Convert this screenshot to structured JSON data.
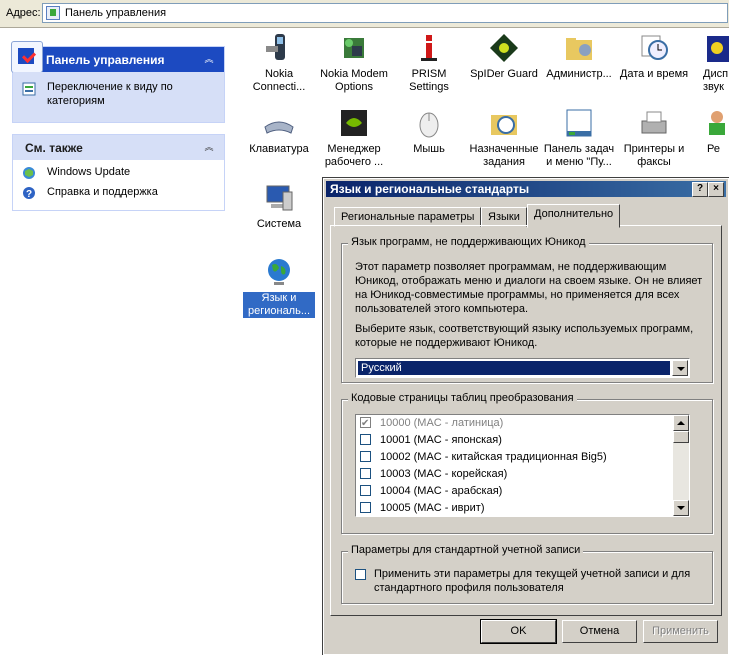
{
  "address": {
    "label": "Адрес:",
    "value": "Панель управления"
  },
  "left": {
    "pane1": {
      "title": "Панель управления",
      "link": "Переключение к виду по категориям"
    },
    "pane2": {
      "title": "См. также",
      "items": [
        "Windows Update",
        "Справка и поддержка"
      ]
    }
  },
  "icons": [
    {
      "name": "Nokia\nConnecti...",
      "icon": "phone-icon"
    },
    {
      "name": "Nokia Modem\nOptions",
      "icon": "modem-icon"
    },
    {
      "name": "PRISM\nSettings",
      "icon": "info-icon"
    },
    {
      "name": "SpIDer Guard",
      "icon": "spider-icon"
    },
    {
      "name": "Администр...",
      "icon": "admin-tools-icon"
    },
    {
      "name": "Дата и время",
      "icon": "clock-icon"
    },
    {
      "name": "Дисп\nзвук",
      "icon": "sound-icon"
    },
    {
      "name": "Клавиатура",
      "icon": "keyboard-icon"
    },
    {
      "name": "Менеджер\nрабочего ...",
      "icon": "nvidia-icon"
    },
    {
      "name": "Мышь",
      "icon": "mouse-icon"
    },
    {
      "name": "Назначенные\nзадания",
      "icon": "tasks-icon"
    },
    {
      "name": "Панель задач\nи меню \"Пу...",
      "icon": "taskbar-icon"
    },
    {
      "name": "Принтеры и\nфаксы",
      "icon": "printer-icon"
    },
    {
      "name": "Ре",
      "icon": "user-icon"
    },
    {
      "name": "Система",
      "icon": "system-icon"
    },
    {
      "name": "Язык и\nрегиональ...",
      "icon": "globe-icon"
    }
  ],
  "dialog": {
    "title": "Язык и региональные стандарты",
    "help_btn": "?",
    "close_btn": "×",
    "tabs": [
      "Региональные параметры",
      "Языки",
      "Дополнительно"
    ],
    "active_tab": 2,
    "group1": {
      "title": "Язык программ, не поддерживающих Юникод",
      "text1": "Этот параметр позволяет программам, не поддерживающим Юникод, отображать меню и диалоги на своем языке. Он не влияет на Юникод-совместимые программы, но применяется для всех пользователей этого компьютера.",
      "text2": "Выберите язык, соответствующий языку используемых программ, которые не поддерживают Юникод.",
      "selected_language": "Русский"
    },
    "group2": {
      "title": "Кодовые страницы таблиц преобразования",
      "items": [
        {
          "label": "10000 (MAC - латиница)",
          "checked": true,
          "dim": true
        },
        {
          "label": "10001 (MAC - японская)",
          "checked": false,
          "dim": false
        },
        {
          "label": "10002 (MAC - китайская традиционная Big5)",
          "checked": false,
          "dim": false
        },
        {
          "label": "10003 (MAC - корейская)",
          "checked": false,
          "dim": false
        },
        {
          "label": "10004 (MAC - арабская)",
          "checked": false,
          "dim": false
        },
        {
          "label": "10005 (MAC - иврит)",
          "checked": false,
          "dim": false
        }
      ]
    },
    "group3": {
      "title": "Параметры для стандартной учетной записи",
      "checkbox_label": "Применить эти параметры для текущей учетной записи и для стандартного профиля пользователя",
      "checked": false
    },
    "buttons": {
      "ok": "OK",
      "cancel": "Отмена",
      "apply": "Применить"
    }
  },
  "colors": {
    "pane_header": "#1c4ac1",
    "pane_bg": "#d6dff7",
    "dialog_bg": "#d4d0c8",
    "title_start": "#0a246a",
    "title_end": "#3a6ea5",
    "selection": "#316ac5"
  }
}
